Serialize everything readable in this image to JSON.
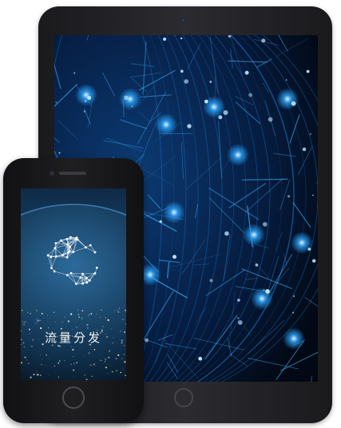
{
  "phone": {
    "title": "流量分发"
  },
  "colors": {
    "tablet_bg": "#04122b",
    "network_glow": "#2aa6ff",
    "node_core": "#bfe9ff"
  },
  "icons": {
    "tablet_home": "home-button",
    "phone_home": "home-button",
    "sphere": "network-sphere-icon"
  }
}
